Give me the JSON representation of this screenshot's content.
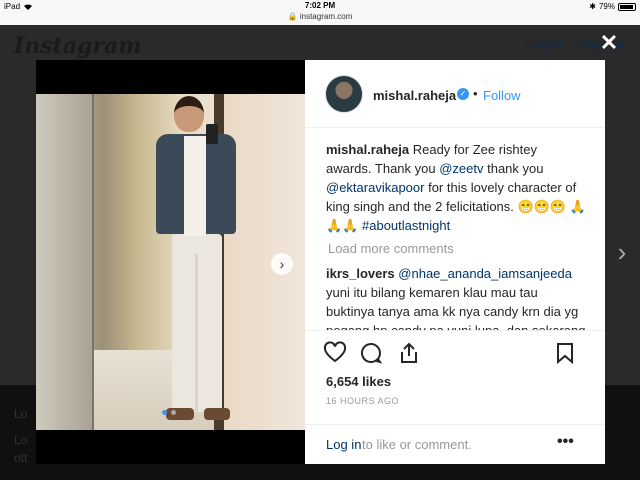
{
  "status_bar": {
    "device": "iPad",
    "time": "7:02 PM",
    "url": "instagram.com",
    "battery": "79%",
    "battery_level": 0.79
  },
  "background_page": {
    "logo": "Instagram",
    "login": "Log in",
    "signup": "Sign up",
    "bottom_text_1": "Lo",
    "bottom_text_2": "Lo",
    "bottom_text_3": "ott"
  },
  "post": {
    "username": "mishal.raheja",
    "separator": "•",
    "follow_label": "Follow",
    "caption": {
      "user": "mishal.raheja",
      "parts": [
        {
          "text": " Ready for Zee rishtey awards. Thank you ",
          "link": false
        },
        {
          "text": "@zeetv",
          "link": true
        },
        {
          "text": " thank you ",
          "link": false
        },
        {
          "text": "@ektaravikapoor",
          "link": true
        },
        {
          "text": " for this lovely character of king singh and the 2 felicitations. 😁😁😁 🙏🙏🙏 ",
          "link": false
        },
        {
          "text": "#aboutlastnight",
          "link": true
        }
      ]
    },
    "load_more": "Load more comments",
    "comment": {
      "user": "ikrs_lovers",
      "mention": "@nhae_ananda_iamsanjeeda",
      "text": " yuni itu bilang kemaren klau mau tau buktinya tanya ama kk nya candy krn dia yg pegang hp candy pa yuni lupa, dan sekarang kamu uda muncul buka donk"
    },
    "likes": "6,654 likes",
    "timestamp": "16 HOURS AGO",
    "login_link": "Log in",
    "login_rest": " to like or comment.",
    "more": "•••",
    "carousel_dots": 2,
    "active_dot": 0
  },
  "icons": {
    "close": "close-icon",
    "heart": "heart-icon",
    "comment": "comment-icon",
    "share": "share-icon",
    "bookmark": "bookmark-icon",
    "verified": "verified-icon",
    "next": "chevron-right-icon"
  },
  "colors": {
    "accent": "#3897f0",
    "link": "#003569",
    "muted": "#999999",
    "text": "#262626"
  }
}
